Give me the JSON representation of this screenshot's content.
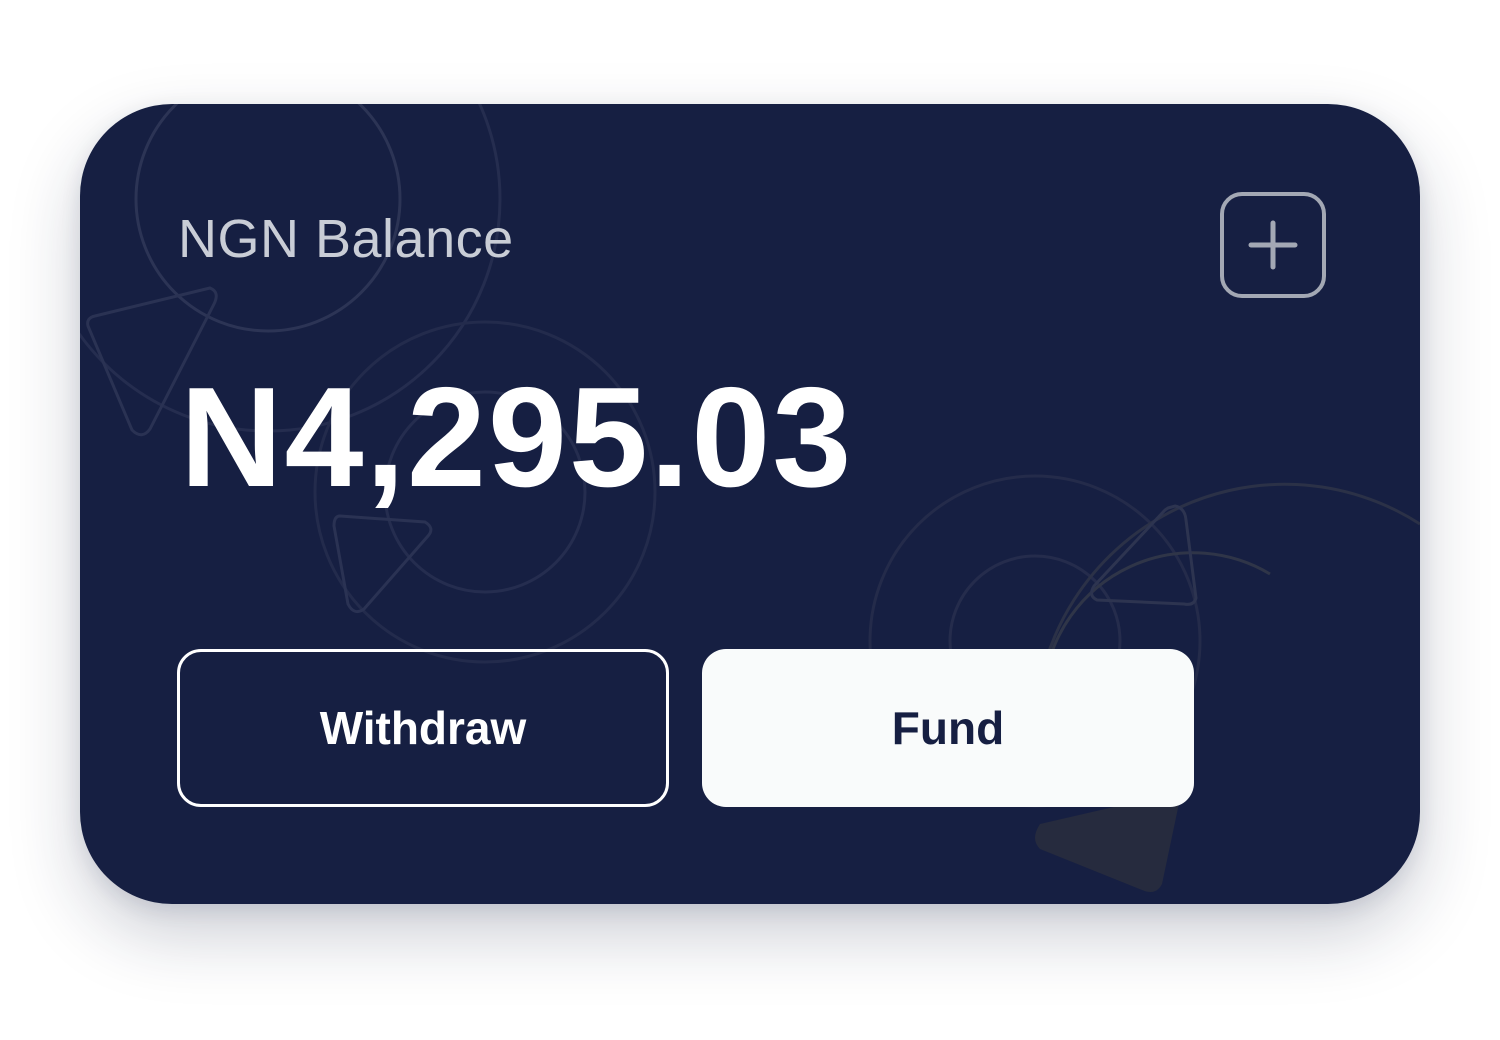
{
  "wallet_card": {
    "balance_label": "NGN Balance",
    "balance_amount": "N4,295.03",
    "add_icon": "plus-icon",
    "withdraw_label": "Withdraw",
    "fund_label": "Fund"
  },
  "colors": {
    "card_background": "#161f42",
    "label_text": "#c9cdd6",
    "amount_text": "#ffffff",
    "fund_button_background": "#f9fbfb",
    "fund_button_text": "#161f42",
    "icon_border": "#a3a8b4"
  }
}
